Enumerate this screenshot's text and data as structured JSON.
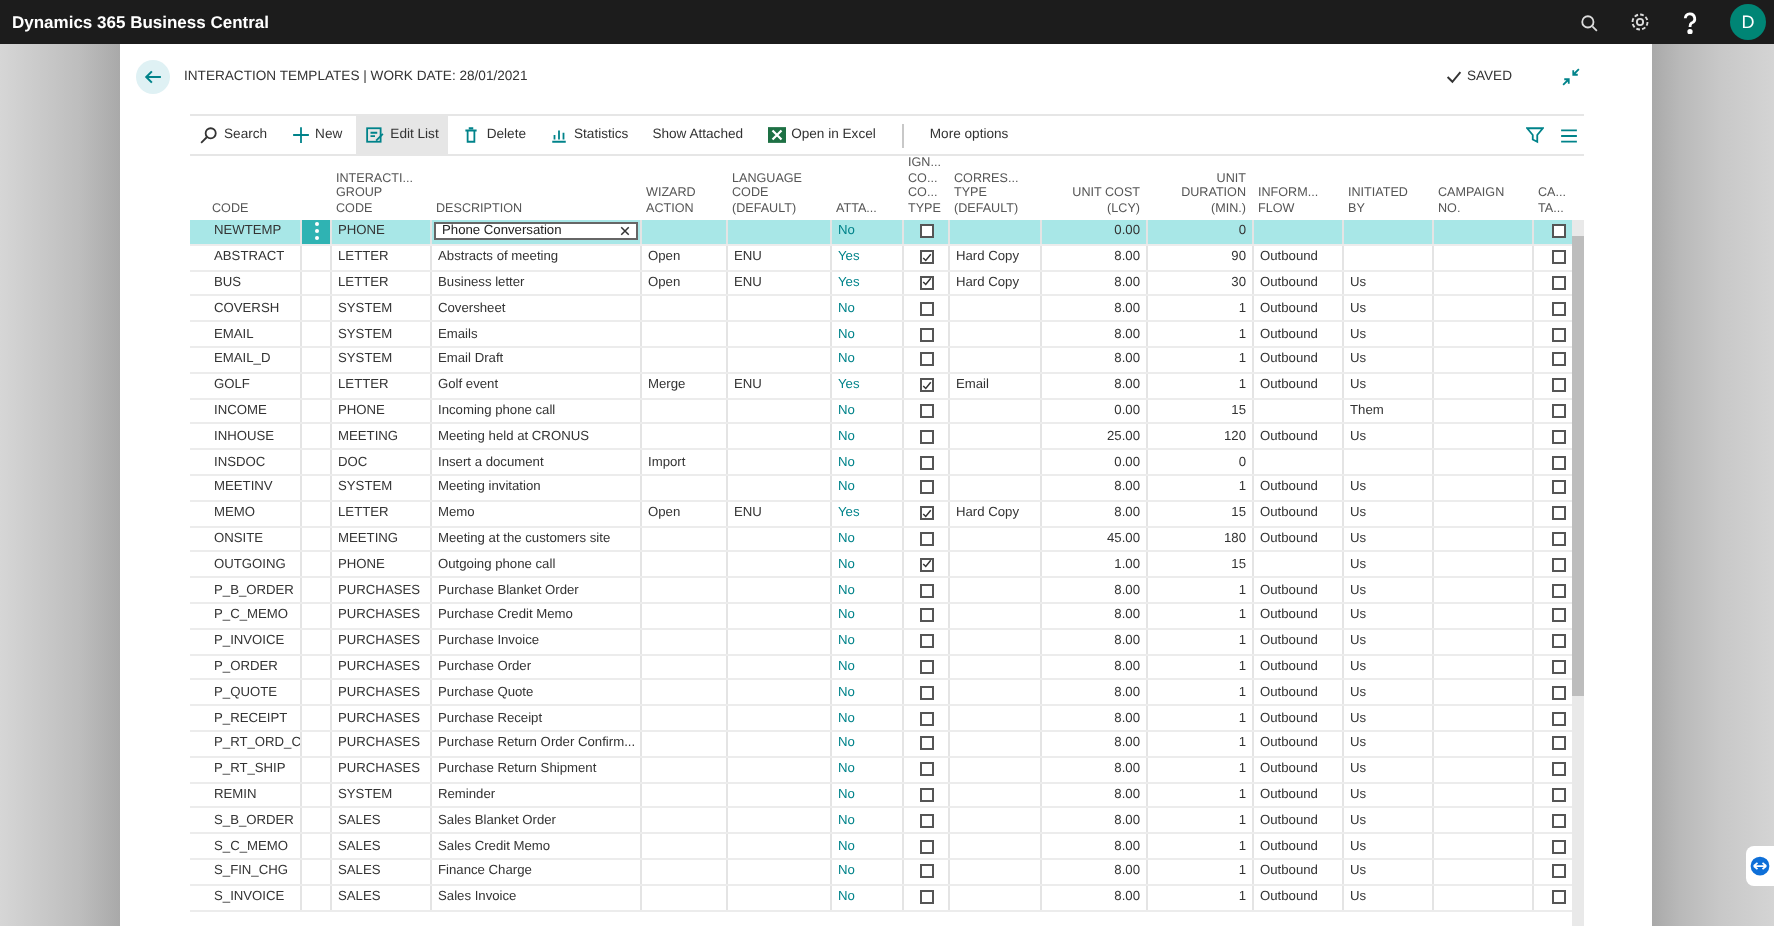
{
  "app_bar": {
    "title": "Dynamics 365 Business Central",
    "avatar": "D"
  },
  "page": {
    "title": "INTERACTION TEMPLATES | WORK DATE: 28/01/2021",
    "status": "SAVED"
  },
  "toolbar": [
    {
      "label": "Search",
      "kind": "search",
      "selected": false
    },
    {
      "label": "New",
      "kind": "new",
      "selected": false
    },
    {
      "label": "Edit List",
      "kind": "edit",
      "selected": true
    },
    {
      "label": "Delete",
      "kind": "delete",
      "selected": false
    },
    {
      "label": "Statistics",
      "kind": "statistics",
      "selected": false
    },
    {
      "label": "Show Attached",
      "kind": "plain",
      "selected": false
    },
    {
      "label": "Open in Excel",
      "kind": "excel",
      "selected": false
    },
    {
      "label": "More options",
      "kind": "more",
      "selected": false
    }
  ],
  "table": {
    "columns": [
      [
        "CODE"
      ],
      [
        "INTERACTI...",
        "GROUP",
        "CODE"
      ],
      [
        "DESCRIPTION"
      ],
      [
        "WIZARD",
        "ACTION"
      ],
      [
        "LANGUAGE",
        "CODE",
        "(DEFAULT)"
      ],
      [
        "ATTA..."
      ],
      [
        "IGN...",
        "CO...",
        "CO...",
        "TYPE"
      ],
      [
        "CORRES...",
        "TYPE",
        "(DEFAULT)"
      ],
      [
        "UNIT COST",
        "(LCY)"
      ],
      [
        "UNIT",
        "DURATION",
        "(MIN.)"
      ],
      [
        "INFORM...",
        "FLOW"
      ],
      [
        "INITIATED",
        "BY"
      ],
      [
        "CAMPAIGN",
        "NO."
      ],
      [
        "CA...",
        "TA..."
      ]
    ],
    "rows": [
      {
        "selected": true,
        "editing": true,
        "code": "NEWTEMP",
        "group": "PHONE",
        "description": "Phone Conversation",
        "attachment": "No",
        "ignore": false,
        "cost": "0.00",
        "duration": "0",
        "ca": false
      },
      {
        "selected": false,
        "code": "ABSTRACT",
        "group": "LETTER",
        "description": "Abstracts of meeting",
        "wizard": "Open",
        "language": "ENU",
        "attachment": "Yes",
        "ignore": true,
        "corres": "Hard Copy",
        "cost": "8.00",
        "duration": "90",
        "flow": "Outbound",
        "ca": false
      },
      {
        "selected": false,
        "code": "BUS",
        "group": "LETTER",
        "description": "Business letter",
        "wizard": "Open",
        "language": "ENU",
        "attachment": "Yes",
        "ignore": true,
        "corres": "Hard Copy",
        "cost": "8.00",
        "duration": "30",
        "flow": "Outbound",
        "initiated": "Us",
        "ca": false
      },
      {
        "selected": false,
        "code": "COVERSH",
        "group": "SYSTEM",
        "description": "Coversheet",
        "attachment": "No",
        "ignore": false,
        "cost": "8.00",
        "duration": "1",
        "flow": "Outbound",
        "initiated": "Us",
        "ca": false
      },
      {
        "selected": false,
        "code": "EMAIL",
        "group": "SYSTEM",
        "description": "Emails",
        "attachment": "No",
        "ignore": false,
        "cost": "8.00",
        "duration": "1",
        "flow": "Outbound",
        "initiated": "Us",
        "ca": false
      },
      {
        "selected": false,
        "code": "EMAIL_D",
        "group": "SYSTEM",
        "description": "Email Draft",
        "attachment": "No",
        "ignore": false,
        "cost": "8.00",
        "duration": "1",
        "flow": "Outbound",
        "initiated": "Us",
        "ca": false
      },
      {
        "selected": false,
        "code": "GOLF",
        "group": "LETTER",
        "description": "Golf event",
        "wizard": "Merge",
        "language": "ENU",
        "attachment": "Yes",
        "ignore": true,
        "corres": "Email",
        "cost": "8.00",
        "duration": "1",
        "flow": "Outbound",
        "initiated": "Us",
        "ca": false
      },
      {
        "selected": false,
        "code": "INCOME",
        "group": "PHONE",
        "description": "Incoming phone call",
        "attachment": "No",
        "ignore": false,
        "cost": "0.00",
        "duration": "15",
        "initiated": "Them",
        "ca": false
      },
      {
        "selected": false,
        "code": "INHOUSE",
        "group": "MEETING",
        "description": "Meeting held at CRONUS",
        "attachment": "No",
        "ignore": false,
        "cost": "25.00",
        "duration": "120",
        "flow": "Outbound",
        "initiated": "Us",
        "ca": false
      },
      {
        "selected": false,
        "code": "INSDOC",
        "group": "DOC",
        "description": "Insert a document",
        "wizard": "Import",
        "attachment": "No",
        "ignore": false,
        "cost": "0.00",
        "duration": "0",
        "ca": false
      },
      {
        "selected": false,
        "code": "MEETINV",
        "group": "SYSTEM",
        "description": "Meeting invitation",
        "attachment": "No",
        "ignore": false,
        "cost": "8.00",
        "duration": "1",
        "flow": "Outbound",
        "initiated": "Us",
        "ca": false
      },
      {
        "selected": false,
        "code": "MEMO",
        "group": "LETTER",
        "description": "Memo",
        "wizard": "Open",
        "language": "ENU",
        "attachment": "Yes",
        "ignore": true,
        "corres": "Hard Copy",
        "cost": "8.00",
        "duration": "15",
        "flow": "Outbound",
        "initiated": "Us",
        "ca": false
      },
      {
        "selected": false,
        "code": "ONSITE",
        "group": "MEETING",
        "description": "Meeting at the customers site",
        "attachment": "No",
        "ignore": false,
        "cost": "45.00",
        "duration": "180",
        "flow": "Outbound",
        "initiated": "Us",
        "ca": false
      },
      {
        "selected": false,
        "code": "OUTGOING",
        "group": "PHONE",
        "description": "Outgoing phone call",
        "attachment": "No",
        "ignore": true,
        "cost": "1.00",
        "duration": "15",
        "initiated": "Us",
        "ca": false
      },
      {
        "selected": false,
        "code": "P_B_ORDER",
        "group": "PURCHASES",
        "description": "Purchase Blanket Order",
        "attachment": "No",
        "ignore": false,
        "cost": "8.00",
        "duration": "1",
        "flow": "Outbound",
        "initiated": "Us",
        "ca": false
      },
      {
        "selected": false,
        "code": "P_C_MEMO",
        "group": "PURCHASES",
        "description": "Purchase Credit Memo",
        "attachment": "No",
        "ignore": false,
        "cost": "8.00",
        "duration": "1",
        "flow": "Outbound",
        "initiated": "Us",
        "ca": false
      },
      {
        "selected": false,
        "code": "P_INVOICE",
        "group": "PURCHASES",
        "description": "Purchase Invoice",
        "attachment": "No",
        "ignore": false,
        "cost": "8.00",
        "duration": "1",
        "flow": "Outbound",
        "initiated": "Us",
        "ca": false
      },
      {
        "selected": false,
        "code": "P_ORDER",
        "group": "PURCHASES",
        "description": "Purchase Order",
        "attachment": "No",
        "ignore": false,
        "cost": "8.00",
        "duration": "1",
        "flow": "Outbound",
        "initiated": "Us",
        "ca": false
      },
      {
        "selected": false,
        "code": "P_QUOTE",
        "group": "PURCHASES",
        "description": "Purchase Quote",
        "attachment": "No",
        "ignore": false,
        "cost": "8.00",
        "duration": "1",
        "flow": "Outbound",
        "initiated": "Us",
        "ca": false
      },
      {
        "selected": false,
        "code": "P_RECEIPT",
        "group": "PURCHASES",
        "description": "Purchase Receipt",
        "attachment": "No",
        "ignore": false,
        "cost": "8.00",
        "duration": "1",
        "flow": "Outbound",
        "initiated": "Us",
        "ca": false
      },
      {
        "selected": false,
        "code": "P_RT_ORD_C",
        "group": "PURCHASES",
        "description": "Purchase Return Order Confirm...",
        "attachment": "No",
        "ignore": false,
        "cost": "8.00",
        "duration": "1",
        "flow": "Outbound",
        "initiated": "Us",
        "ca": false
      },
      {
        "selected": false,
        "code": "P_RT_SHIP",
        "group": "PURCHASES",
        "description": "Purchase Return Shipment",
        "attachment": "No",
        "ignore": false,
        "cost": "8.00",
        "duration": "1",
        "flow": "Outbound",
        "initiated": "Us",
        "ca": false
      },
      {
        "selected": false,
        "code": "REMIN",
        "group": "SYSTEM",
        "description": "Reminder",
        "attachment": "No",
        "ignore": false,
        "cost": "8.00",
        "duration": "1",
        "flow": "Outbound",
        "initiated": "Us",
        "ca": false
      },
      {
        "selected": false,
        "code": "S_B_ORDER",
        "group": "SALES",
        "description": "Sales Blanket Order",
        "attachment": "No",
        "ignore": false,
        "cost": "8.00",
        "duration": "1",
        "flow": "Outbound",
        "initiated": "Us",
        "ca": false
      },
      {
        "selected": false,
        "code": "S_C_MEMO",
        "group": "SALES",
        "description": "Sales Credit Memo",
        "attachment": "No",
        "ignore": false,
        "cost": "8.00",
        "duration": "1",
        "flow": "Outbound",
        "initiated": "Us",
        "ca": false
      },
      {
        "selected": false,
        "code": "S_FIN_CHG",
        "group": "SALES",
        "description": "Finance Charge",
        "attachment": "No",
        "ignore": false,
        "cost": "8.00",
        "duration": "1",
        "flow": "Outbound",
        "initiated": "Us",
        "ca": false
      },
      {
        "selected": false,
        "code": "S_INVOICE",
        "group": "SALES",
        "description": "Sales Invoice",
        "attachment": "No",
        "ignore": false,
        "cost": "8.00",
        "duration": "1",
        "flow": "Outbound",
        "initiated": "Us",
        "ca": false
      }
    ]
  }
}
